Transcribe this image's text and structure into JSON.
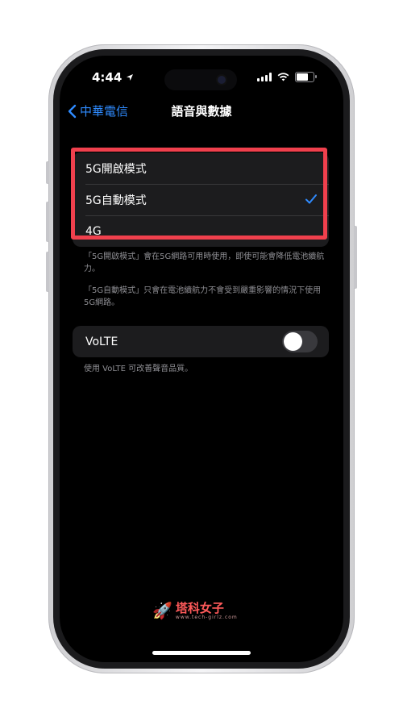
{
  "status_bar": {
    "time": "4:44"
  },
  "nav": {
    "back_label": "中華電信",
    "title": "語音與數據"
  },
  "mode_options": [
    {
      "label": "5G開啟模式",
      "selected": false
    },
    {
      "label": "5G自動模式",
      "selected": true
    },
    {
      "label": "4G",
      "selected": false
    }
  ],
  "mode_footer": {
    "line1": "「5G開啟模式」會在5G網路可用時使用，即使可能會降低電池續航力。",
    "line2": "「5G自動模式」只會在電池續航力不會受到嚴重影響的情況下使用5G網路。"
  },
  "volte": {
    "label": "VoLTE",
    "enabled": false,
    "footer": "使用 VoLTE 可改善聲音品質。"
  },
  "watermark": {
    "name": "塔科女子",
    "url": "www.tech-girlz.com"
  },
  "colors": {
    "accent": "#2f8bff",
    "highlight": "#f0404d",
    "background": "#000000",
    "cell": "#1c1c1e"
  }
}
